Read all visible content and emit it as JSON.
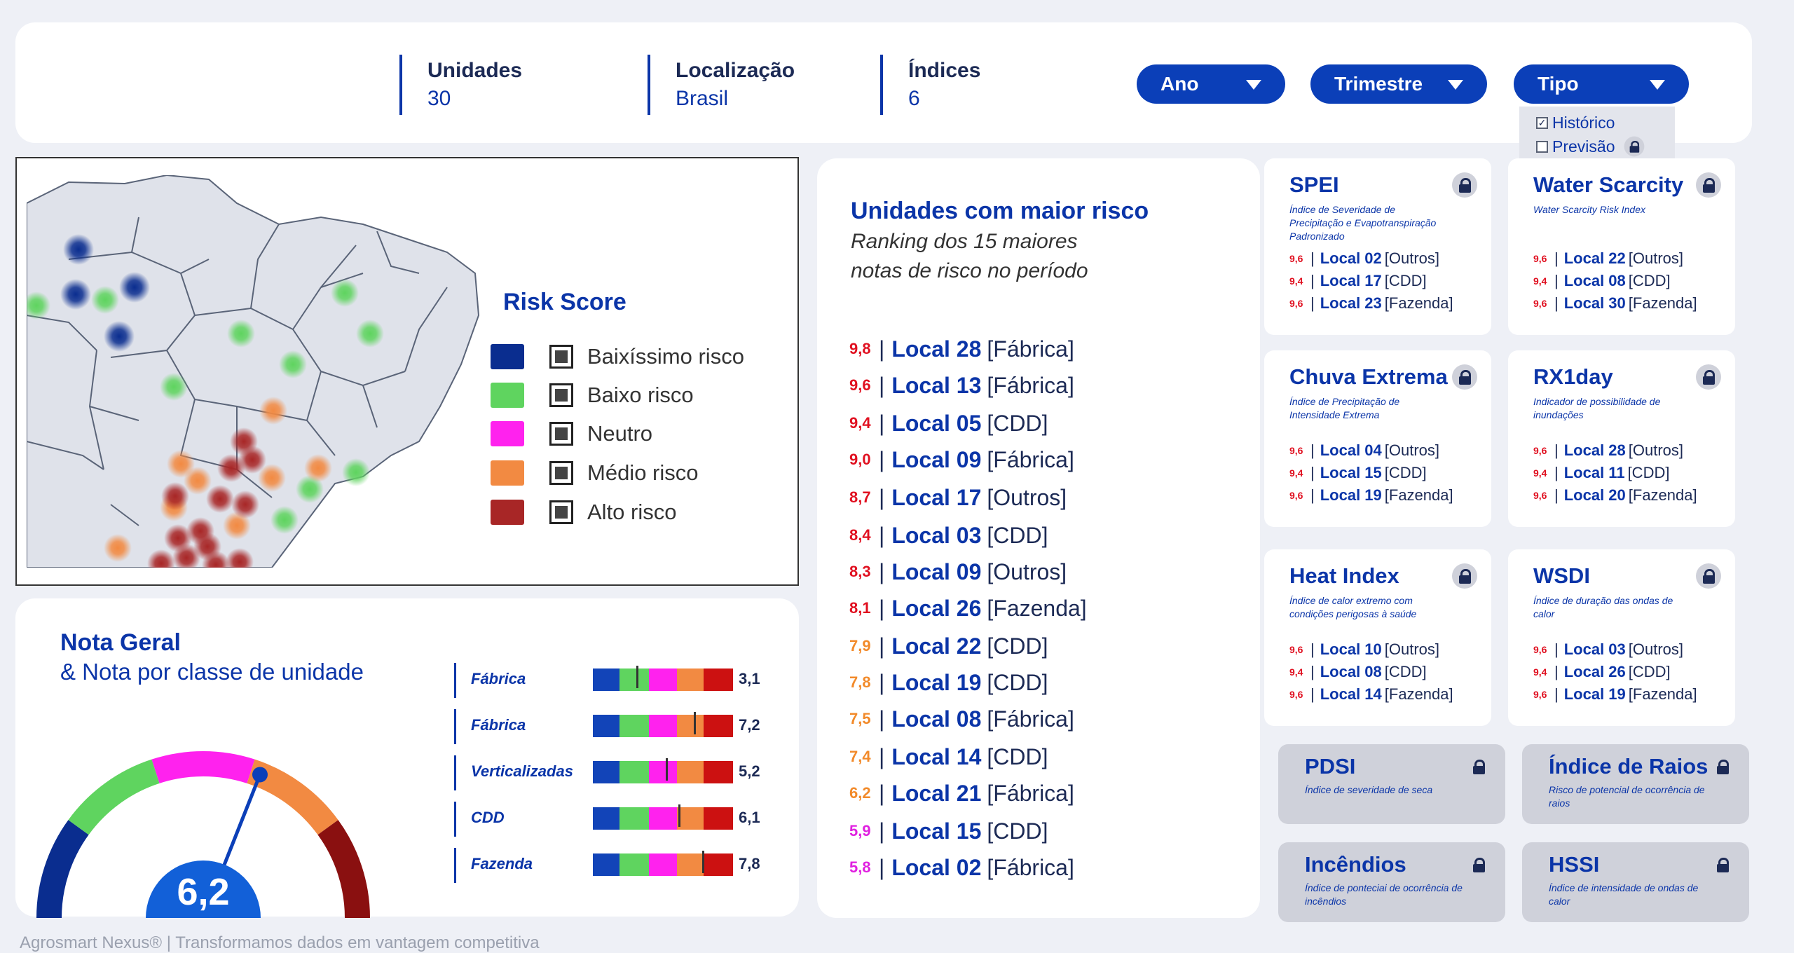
{
  "header": {
    "kpis": [
      {
        "label": "Unidades",
        "value": "30"
      },
      {
        "label": "Localização",
        "value": "Brasil"
      },
      {
        "label": "Índices",
        "value": "6"
      }
    ],
    "filters": {
      "ano": "Ano",
      "trimestre": "Trimestre",
      "tipo": "Tipo"
    },
    "tipo_options": [
      {
        "label": "Histórico",
        "checked": true,
        "locked": false
      },
      {
        "label": "Previsão",
        "checked": false,
        "locked": true
      }
    ]
  },
  "map": {
    "legend_title": "Risk Score",
    "legend": [
      {
        "label": "Baixíssimo risco",
        "color": "#0a2d8f"
      },
      {
        "label": "Baixo risco",
        "color": "#5fd45f"
      },
      {
        "label": "Neutro",
        "color": "#ff22ee"
      },
      {
        "label": "Médio risco",
        "color": "#f28a42"
      },
      {
        "label": "Alto risco",
        "color": "#a82626"
      }
    ]
  },
  "ranking": {
    "title": "Unidades com maior risco",
    "subtitle_line1": "Ranking dos 15 maiores",
    "subtitle_line2": "notas de risco no período",
    "items": [
      {
        "score": "9,8",
        "local": "Local 28",
        "type": "[Fábrica]",
        "color": "#e01020"
      },
      {
        "score": "9,6",
        "local": "Local 13",
        "type": "[Fábrica]",
        "color": "#e01020"
      },
      {
        "score": "9,4",
        "local": "Local 05",
        "type": "[CDD]",
        "color": "#e01020"
      },
      {
        "score": "9,0",
        "local": "Local 09",
        "type": "[Fábrica]",
        "color": "#e01020"
      },
      {
        "score": "8,7",
        "local": "Local 17",
        "type": "[Outros]",
        "color": "#e01020"
      },
      {
        "score": "8,4",
        "local": "Local 03",
        "type": "[CDD]",
        "color": "#e01020"
      },
      {
        "score": "8,3",
        "local": "Local 09",
        "type": "[Outros]",
        "color": "#e01020"
      },
      {
        "score": "8,1",
        "local": "Local 26",
        "type": "[Fazenda]",
        "color": "#e01020"
      },
      {
        "score": "7,9",
        "local": "Local 22",
        "type": "[CDD]",
        "color": "#f28a2a"
      },
      {
        "score": "7,8",
        "local": "Local 19",
        "type": "[CDD]",
        "color": "#f28a2a"
      },
      {
        "score": "7,5",
        "local": "Local 08",
        "type": "[Fábrica]",
        "color": "#f28a2a"
      },
      {
        "score": "7,4",
        "local": "Local 14",
        "type": "[CDD]",
        "color": "#f28a2a"
      },
      {
        "score": "6,2",
        "local": "Local 21",
        "type": "[Fábrica]",
        "color": "#f28a2a"
      },
      {
        "score": "5,9",
        "local": "Local 15",
        "type": "[CDD]",
        "color": "#e020e0"
      },
      {
        "score": "5,8",
        "local": "Local 02",
        "type": "[Fábrica]",
        "color": "#e020e0"
      }
    ]
  },
  "indices": [
    {
      "title": "SPEI",
      "subtitle": "Índice de Severidade de Precipitação e Evapotranspiração Padronizado",
      "rows": [
        {
          "score": "9,6",
          "local": "Local 02",
          "type": "[Outros]"
        },
        {
          "score": "9,4",
          "local": "Local 17",
          "type": "[CDD]"
        },
        {
          "score": "9,6",
          "local": "Local 23",
          "type": "[Fazenda]"
        }
      ]
    },
    {
      "title": "Water Scarcity",
      "subtitle": "Water Scarcity Risk Index",
      "rows": [
        {
          "score": "9,6",
          "local": "Local 22",
          "type": "[Outros]"
        },
        {
          "score": "9,4",
          "local": "Local 08",
          "type": "[CDD]"
        },
        {
          "score": "9,6",
          "local": "Local 30",
          "type": "[Fazenda]"
        }
      ]
    },
    {
      "title": "Chuva Extrema",
      "subtitle": "Índice de Precipitação de Intensidade Extrema",
      "rows": [
        {
          "score": "9,6",
          "local": "Local 04",
          "type": "[Outros]"
        },
        {
          "score": "9,4",
          "local": "Local 15",
          "type": "[CDD]"
        },
        {
          "score": "9,6",
          "local": "Local 19",
          "type": "[Fazenda]"
        }
      ]
    },
    {
      "title": "RX1day",
      "subtitle": "Indicador de possibilidade de inundações",
      "rows": [
        {
          "score": "9,6",
          "local": "Local 28",
          "type": "[Outros]"
        },
        {
          "score": "9,4",
          "local": "Local 11",
          "type": "[CDD]"
        },
        {
          "score": "9,6",
          "local": "Local 20",
          "type": "[Fazenda]"
        }
      ]
    },
    {
      "title": "Heat Index",
      "subtitle": "Índice de calor extremo com condições perigosas à saúde",
      "rows": [
        {
          "score": "9,6",
          "local": "Local 10",
          "type": "[Outros]"
        },
        {
          "score": "9,4",
          "local": "Local 08",
          "type": "[CDD]"
        },
        {
          "score": "9,6",
          "local": "Local 14",
          "type": "[Fazenda]"
        }
      ]
    },
    {
      "title": "WSDI",
      "subtitle": "Índice de duração das ondas de calor",
      "rows": [
        {
          "score": "9,6",
          "local": "Local 03",
          "type": "[Outros]"
        },
        {
          "score": "9,4",
          "local": "Local 26",
          "type": "[CDD]"
        },
        {
          "score": "9,6",
          "local": "Local 19",
          "type": "[Fazenda]"
        }
      ]
    }
  ],
  "locked_indices": [
    {
      "title": "PDSI",
      "subtitle": "Índice de severidade de seca"
    },
    {
      "title": "Índice de Raios",
      "subtitle": "Risco de potencial de ocorrência de raios"
    },
    {
      "title": "Incêndios",
      "subtitle": "Índice de ponteciai de ocorrência de incêndios"
    },
    {
      "title": "HSSI",
      "subtitle": "Índice de intensidade de ondas de calor"
    }
  ],
  "nota": {
    "title": "Nota Geral",
    "subtitle": "& Nota por classe de unidade",
    "overall": "6,2",
    "overall_value": 6.2,
    "classes": [
      {
        "label": "Fábrica",
        "value": "3,1",
        "score": 3.1
      },
      {
        "label": "Fábrica",
        "value": "7,2",
        "score": 7.2
      },
      {
        "label": "Verticalizadas",
        "value": "5,2",
        "score": 5.2
      },
      {
        "label": "CDD",
        "value": "6,1",
        "score": 6.1
      },
      {
        "label": "Fazenda",
        "value": "7,8",
        "score": 7.8
      }
    ],
    "scale_colors": [
      "#1244b8",
      "#5fd45f",
      "#ff22ee",
      "#f28a42",
      "#cc1111"
    ]
  },
  "footer": "Agrosmart Nexus® | Transformamos dados em vantagem competitiva"
}
